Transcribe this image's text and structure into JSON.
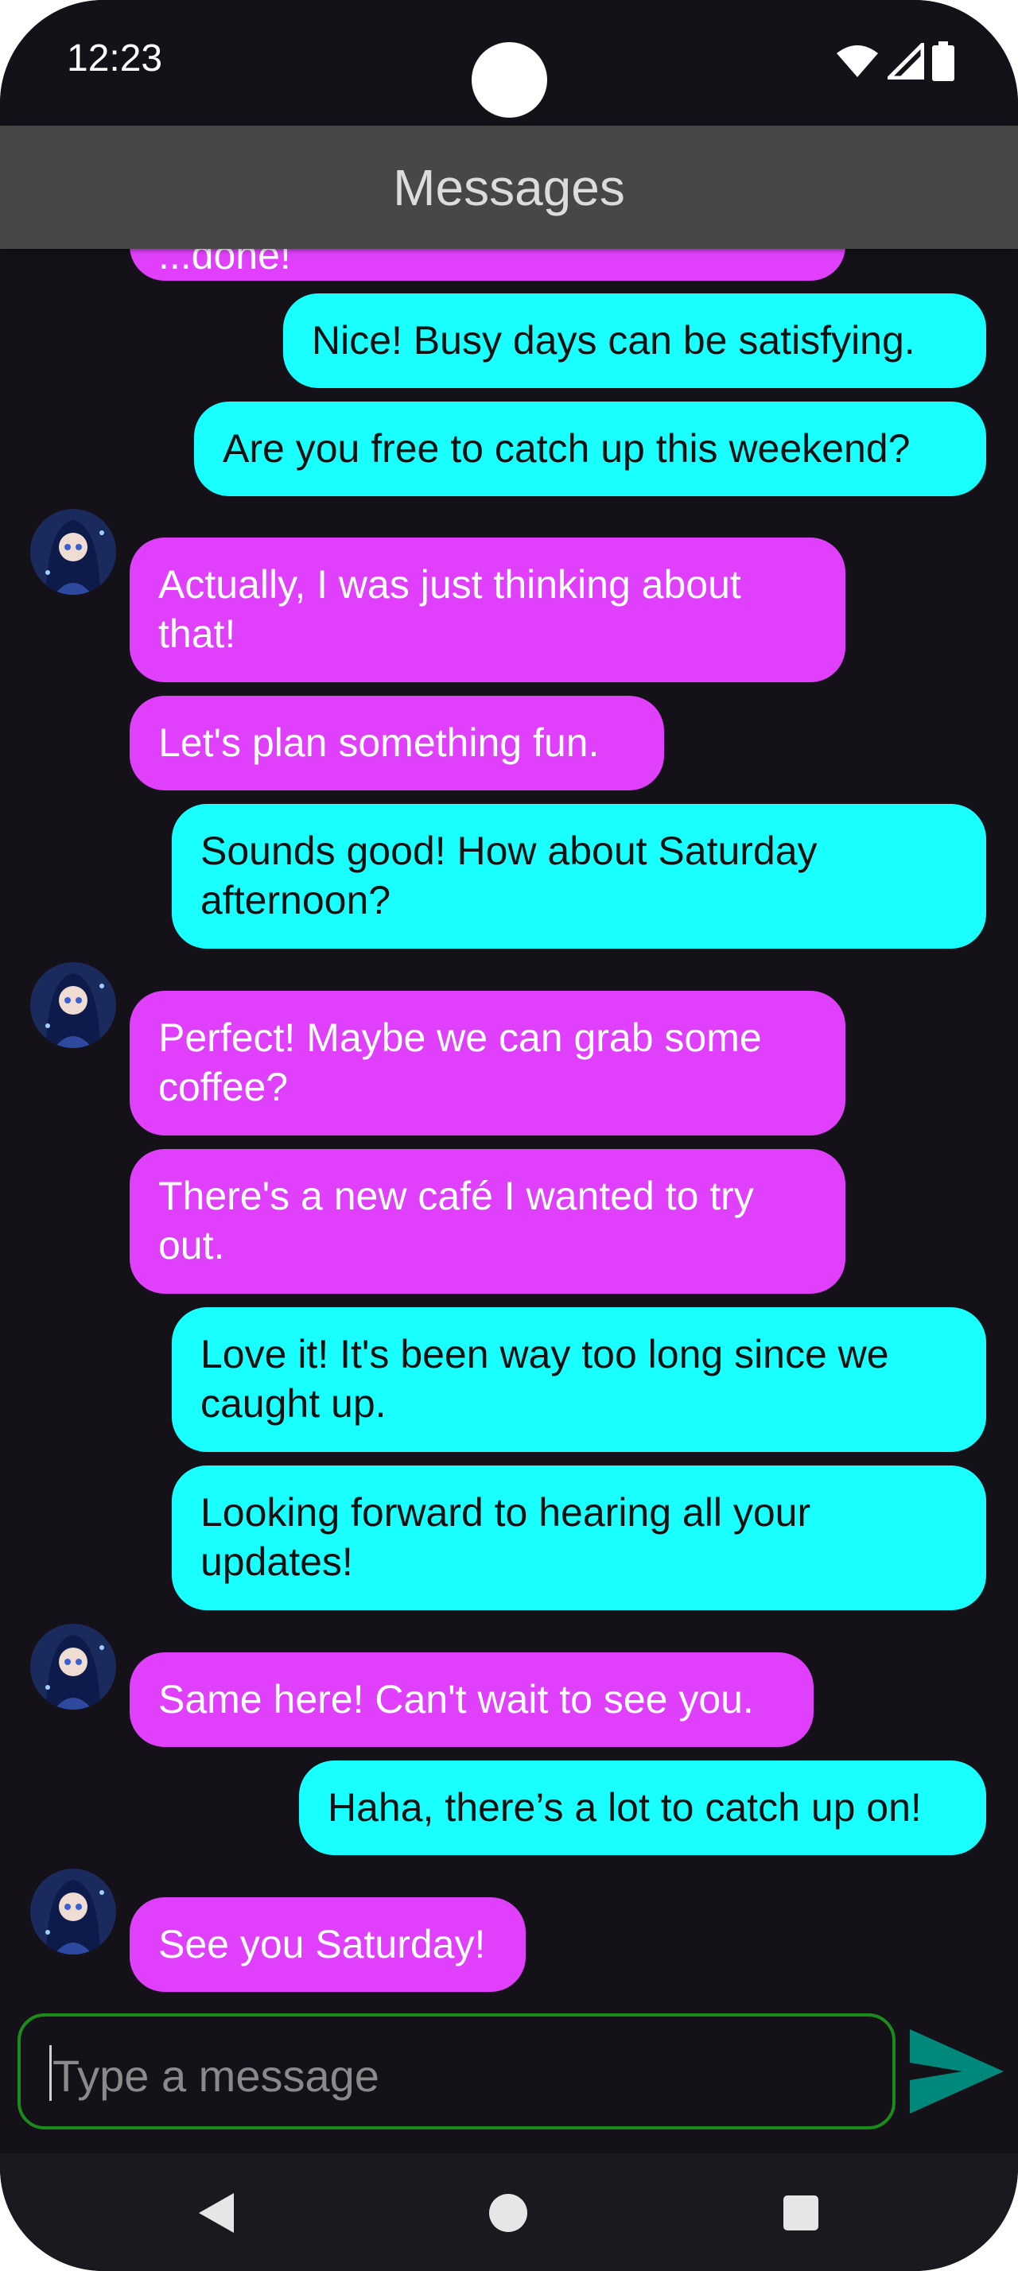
{
  "status_bar": {
    "time": "12:23",
    "icons": [
      "wifi-icon",
      "signal-icon",
      "battery-icon"
    ]
  },
  "app_bar": {
    "title": "Messages"
  },
  "messages": [
    {
      "from": "them",
      "text": "...done!"
    },
    {
      "from": "me",
      "text": "Nice! Busy days can be satisfying."
    },
    {
      "from": "me",
      "text": "Are you free to catch up this weekend?"
    },
    {
      "from": "them",
      "text": "Actually, I was just thinking about that!"
    },
    {
      "from": "them",
      "text": "Let's plan something fun."
    },
    {
      "from": "me",
      "text": "Sounds good! How about Saturday afternoon?"
    },
    {
      "from": "them",
      "text": "Perfect! Maybe we can grab some coffee?"
    },
    {
      "from": "them",
      "text": "There's a new café I wanted to try out."
    },
    {
      "from": "me",
      "text": "Love it! It's been way too long since we caught up."
    },
    {
      "from": "me",
      "text": "Looking forward to hearing all your updates!"
    },
    {
      "from": "them",
      "text": "Same here! Can't wait to see you."
    },
    {
      "from": "me",
      "text": "Haha, there’s a lot to catch up on!"
    },
    {
      "from": "them",
      "text": "See you Saturday!"
    }
  ],
  "composer": {
    "placeholder": "Type a message",
    "value": "",
    "send_icon": "send-icon"
  },
  "nav_bar": {
    "icons": [
      "back-icon",
      "home-icon",
      "recents-icon"
    ]
  },
  "colors": {
    "incoming": "#e040fb",
    "outgoing": "#19ffff",
    "background": "#141218",
    "app_bar": "#474747",
    "send": "#00897b",
    "input_border": "#1a8c1a"
  }
}
